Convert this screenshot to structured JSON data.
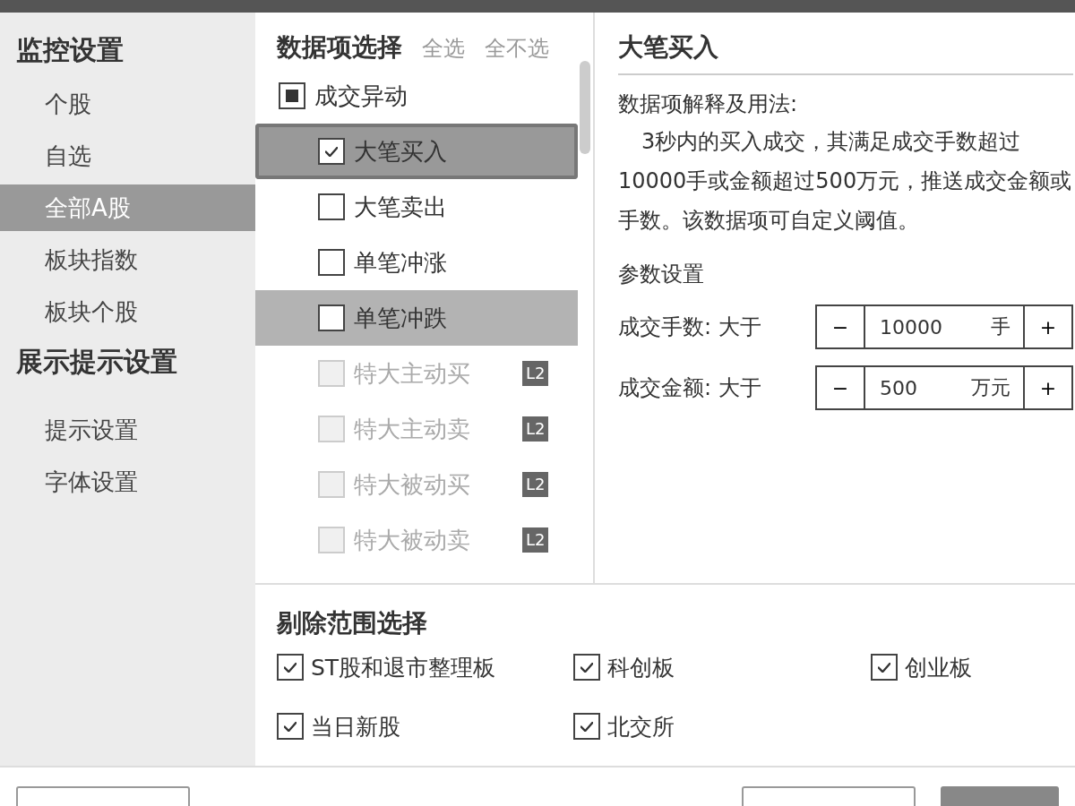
{
  "sidebar": {
    "groups": [
      {
        "title": "监控设置",
        "items": [
          {
            "label": "个股",
            "selected": false
          },
          {
            "label": "自选",
            "selected": false
          },
          {
            "label": "全部A股",
            "selected": true
          },
          {
            "label": "板块指数",
            "selected": false
          },
          {
            "label": "板块个股",
            "selected": false
          }
        ]
      },
      {
        "title": "展示提示设置",
        "items": [
          {
            "label": "提示设置",
            "selected": false
          },
          {
            "label": "字体设置",
            "selected": false
          }
        ]
      }
    ]
  },
  "data_items": {
    "title": "数据项选择",
    "select_all": "全选",
    "select_none": "全不选",
    "items": [
      {
        "label": "成交异动",
        "checked": false,
        "partial": true,
        "selected": false,
        "highlighted": false,
        "disabled": false,
        "focused": false,
        "children": [
          {
            "label": "大笔买入",
            "checked": true,
            "partial": false,
            "selected": true,
            "highlighted": false,
            "disabled": false,
            "focused": true
          },
          {
            "label": "大笔卖出",
            "checked": false,
            "partial": false,
            "selected": false,
            "highlighted": false,
            "disabled": false,
            "focused": false
          },
          {
            "label": "单笔冲涨",
            "checked": false,
            "partial": false,
            "selected": false,
            "highlighted": false,
            "disabled": false,
            "focused": false
          },
          {
            "label": "单笔冲跌",
            "checked": false,
            "partial": false,
            "selected": false,
            "highlighted": true,
            "disabled": false,
            "focused": false
          },
          {
            "label": "特大主动买",
            "checked": false,
            "partial": false,
            "selected": false,
            "highlighted": false,
            "disabled": true,
            "focused": false,
            "badge": "L2"
          },
          {
            "label": "特大主动卖",
            "checked": false,
            "partial": false,
            "selected": false,
            "highlighted": false,
            "disabled": true,
            "focused": false,
            "badge": "L2"
          },
          {
            "label": "特大被动买",
            "checked": false,
            "partial": false,
            "selected": false,
            "highlighted": false,
            "disabled": true,
            "focused": false,
            "badge": "L2"
          },
          {
            "label": "特大被动卖",
            "checked": false,
            "partial": false,
            "selected": false,
            "highlighted": false,
            "disabled": true,
            "focused": false,
            "badge": "L2"
          }
        ]
      }
    ]
  },
  "detail": {
    "title": "大笔买入",
    "explain_heading": "数据项解释及用法:",
    "explanation": "3秒内的买入成交，其满足成交手数超过10000手或金额超过500万元，推送成交金额或手数。该数据项可自定义阈值。",
    "params_heading": "参数设置",
    "params": [
      {
        "label": "成交手数: 大于",
        "minus": "−",
        "value": "10000",
        "unit": "手",
        "plus": "+"
      },
      {
        "label": "成交金额: 大于",
        "minus": "−",
        "value": "500",
        "unit": "万元",
        "plus": "+"
      }
    ]
  },
  "exclusion": {
    "title": "剔除范围选择",
    "options": [
      {
        "label": "ST股和退市整理板",
        "checked": true
      },
      {
        "label": "科创板",
        "checked": true
      },
      {
        "label": "创业板",
        "checked": true
      },
      {
        "label": "当日新股",
        "checked": true
      },
      {
        "label": "北交所",
        "checked": true
      }
    ]
  },
  "footer_buttons": [
    {
      "kind": "default"
    },
    {
      "kind": "default"
    },
    {
      "kind": "primary"
    }
  ]
}
